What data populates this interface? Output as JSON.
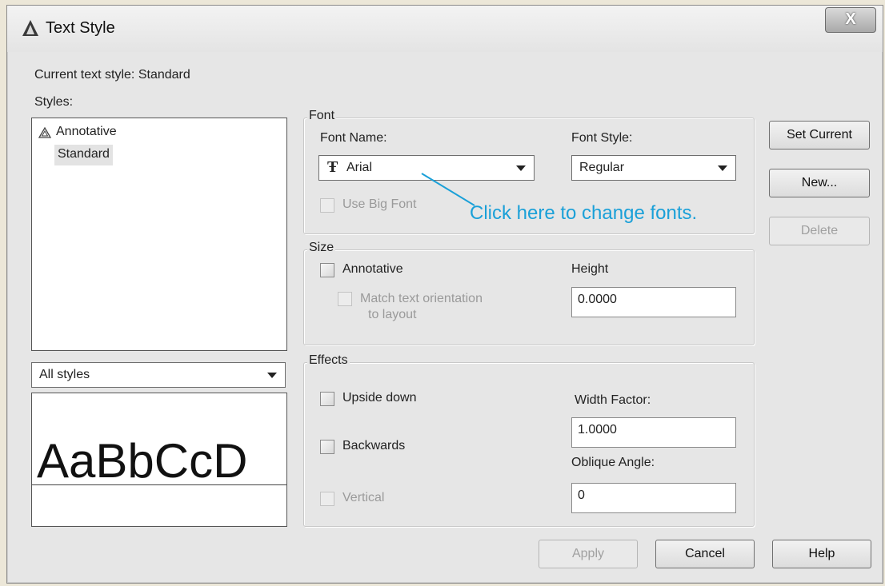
{
  "window": {
    "title": "Text Style",
    "close_label": "X"
  },
  "current_style": {
    "label": "Current text style:",
    "value": "Standard"
  },
  "styles": {
    "label": "Styles:",
    "items": [
      {
        "label": "Annotative",
        "annotative": true
      },
      {
        "label": "Standard",
        "selected": true
      }
    ]
  },
  "filter": {
    "selected": "All styles"
  },
  "preview": {
    "text": "AaBbCcD"
  },
  "font": {
    "group_label": "Font",
    "name_label": "Font Name:",
    "name_value": "Arial",
    "style_label": "Font Style:",
    "style_value": "Regular",
    "big_font_label": "Use Big Font"
  },
  "callout": {
    "text": "Click here to change fonts.",
    "color": "#1aa0d8"
  },
  "size": {
    "group_label": "Size",
    "annotative_label": "Annotative",
    "match_line1": "Match text orientation",
    "match_line2": "to layout",
    "height_label": "Height",
    "height_value": "0.0000"
  },
  "effects": {
    "group_label": "Effects",
    "upside_down_label": "Upside down",
    "backwards_label": "Backwards",
    "vertical_label": "Vertical",
    "width_label": "Width Factor:",
    "width_value": "1.0000",
    "oblique_label": "Oblique Angle:",
    "oblique_value": "0"
  },
  "buttons": {
    "set_current": "Set Current",
    "new": "New...",
    "delete": "Delete",
    "apply": "Apply",
    "cancel": "Cancel",
    "help": "Help"
  }
}
